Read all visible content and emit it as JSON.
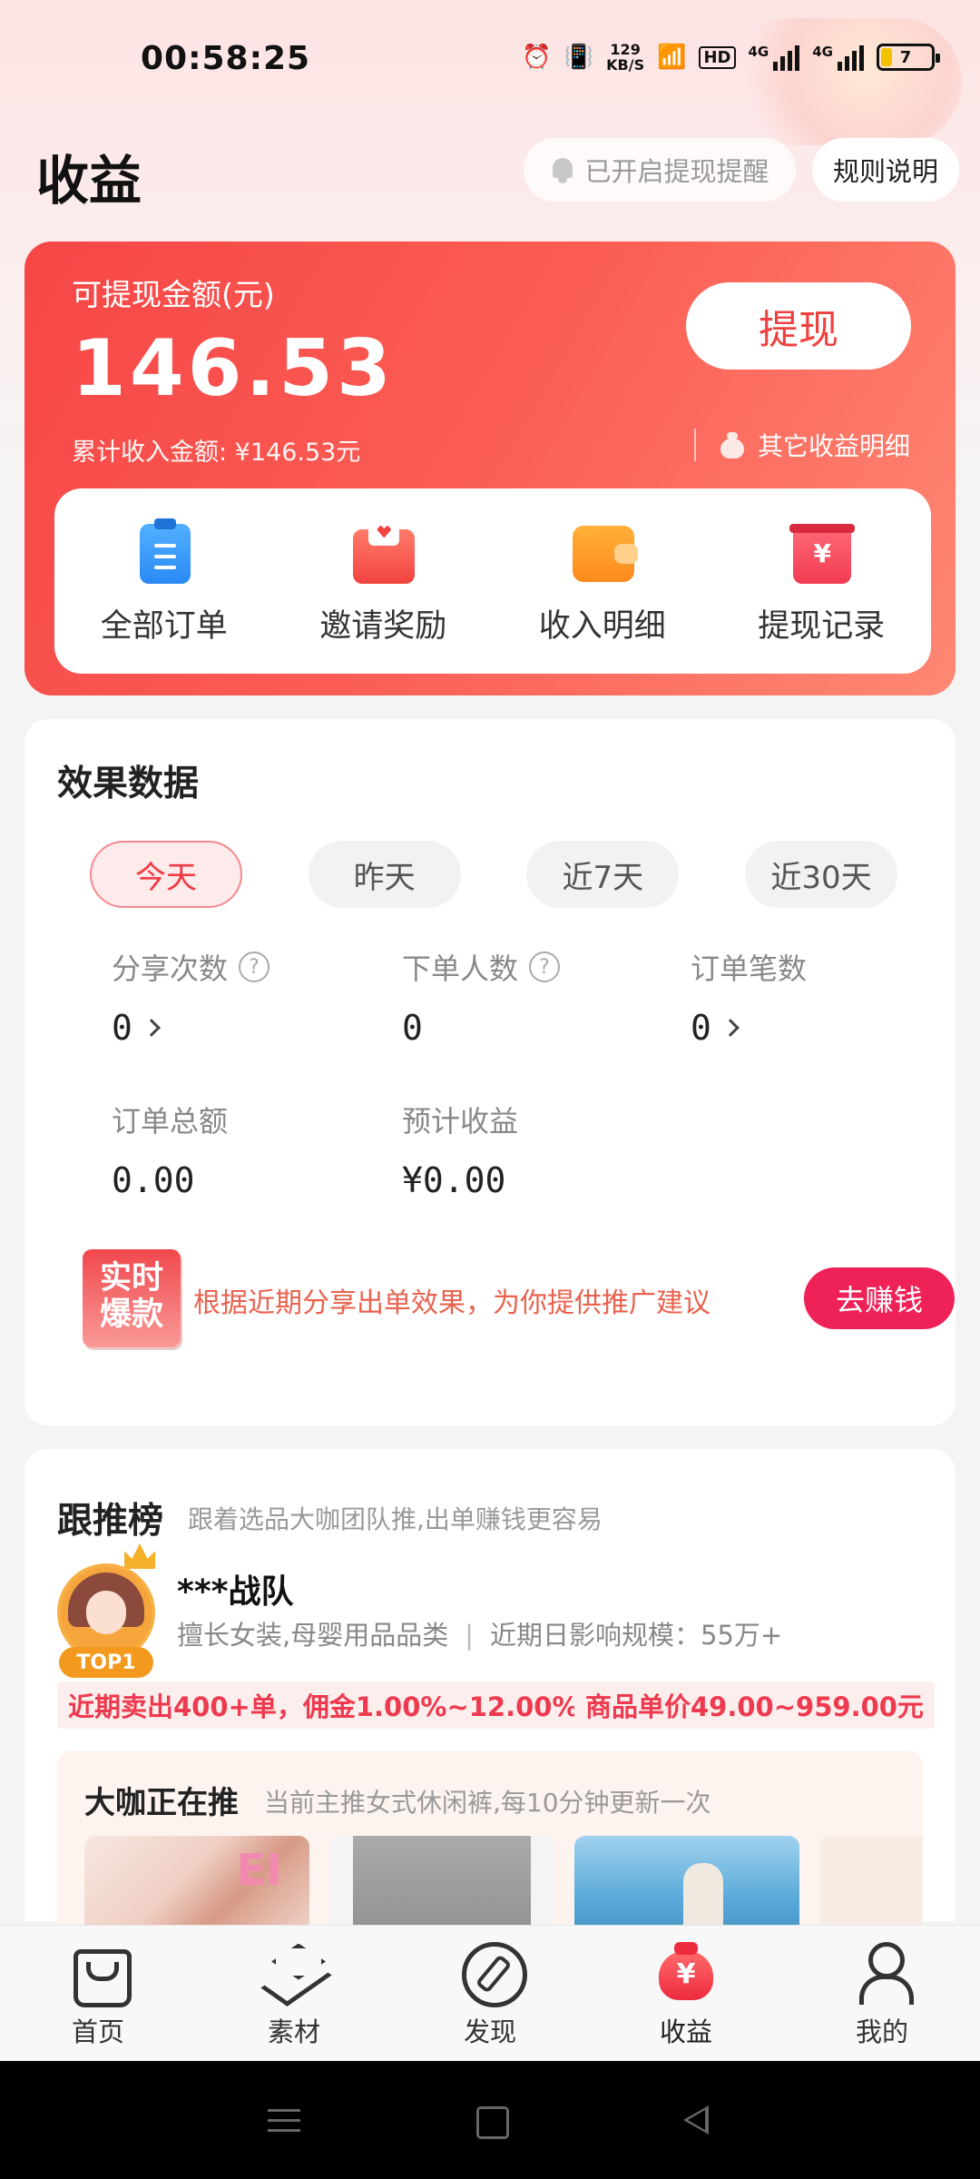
{
  "status_bar": {
    "time": "00:58:25",
    "net_speed_value": "129",
    "net_speed_unit": "KB/S",
    "hd_label": "HD",
    "signal1_label": "4G",
    "signal2_label": "4G",
    "battery_level": "7"
  },
  "header": {
    "title": "收益",
    "remind_label": "已开启提现提醒",
    "rules_label": "规则说明"
  },
  "earnings": {
    "label": "可提现金额(元)",
    "amount": "146.53",
    "total_label": "累计收入金额: ¥146.53元",
    "withdraw_button": "提现",
    "other_income_label": "其它收益明细"
  },
  "quick_actions": [
    {
      "label": "全部订单",
      "icon": "clipboard-icon"
    },
    {
      "label": "邀请奖励",
      "icon": "invite-envelope-icon"
    },
    {
      "label": "收入明细",
      "icon": "wallet-icon"
    },
    {
      "label": "提现记录",
      "icon": "withdraw-record-icon"
    }
  ],
  "stats": {
    "title": "效果数据",
    "tabs": [
      {
        "label": "今天",
        "active": true
      },
      {
        "label": "昨天",
        "active": false
      },
      {
        "label": "近7天",
        "active": false
      },
      {
        "label": "近30天",
        "active": false
      }
    ],
    "metrics": [
      {
        "label": "分享次数",
        "value": "0"
      },
      {
        "label": "下单人数",
        "value": "0"
      },
      {
        "label": "订单笔数",
        "value": "0"
      },
      {
        "label": "订单总额",
        "value": "0.00"
      },
      {
        "label": "预计收益",
        "value": "¥0.00"
      }
    ],
    "hot_badge_line1": "实时",
    "hot_badge_line2": "爆款",
    "hot_text": "根据近期分享出单效果，为你提供推广建议",
    "earn_button": "去赚钱"
  },
  "follow": {
    "title": "跟推榜",
    "subtitle": "跟着选品大咖团队推,出单赚钱更容易",
    "rank_badge": "TOP1",
    "team_name": "***战队",
    "team_category": "擅长女装,母婴用品品类",
    "team_separator": "|",
    "team_scale": "近期日影响规模：55万+",
    "tag_sales": "近期卖出400+单，佣金1.00%~12.00%",
    "tag_price": "商品单价49.00~959.00元",
    "pushing_title": "大咖正在推",
    "pushing_sub": "当前主推女式休闲裤,每10分钟更新一次"
  },
  "bottom_nav": [
    {
      "label": "首页",
      "icon": "shopping-bag-icon"
    },
    {
      "label": "素材",
      "icon": "layers-icon"
    },
    {
      "label": "发现",
      "icon": "compass-icon"
    },
    {
      "label": "收益",
      "icon": "money-bag-icon",
      "active": true
    },
    {
      "label": "我的",
      "icon": "user-icon"
    }
  ],
  "colors": {
    "accent_red": "#f64646",
    "earn_button": "#ee2257",
    "tag_text": "#ee3a4e"
  }
}
